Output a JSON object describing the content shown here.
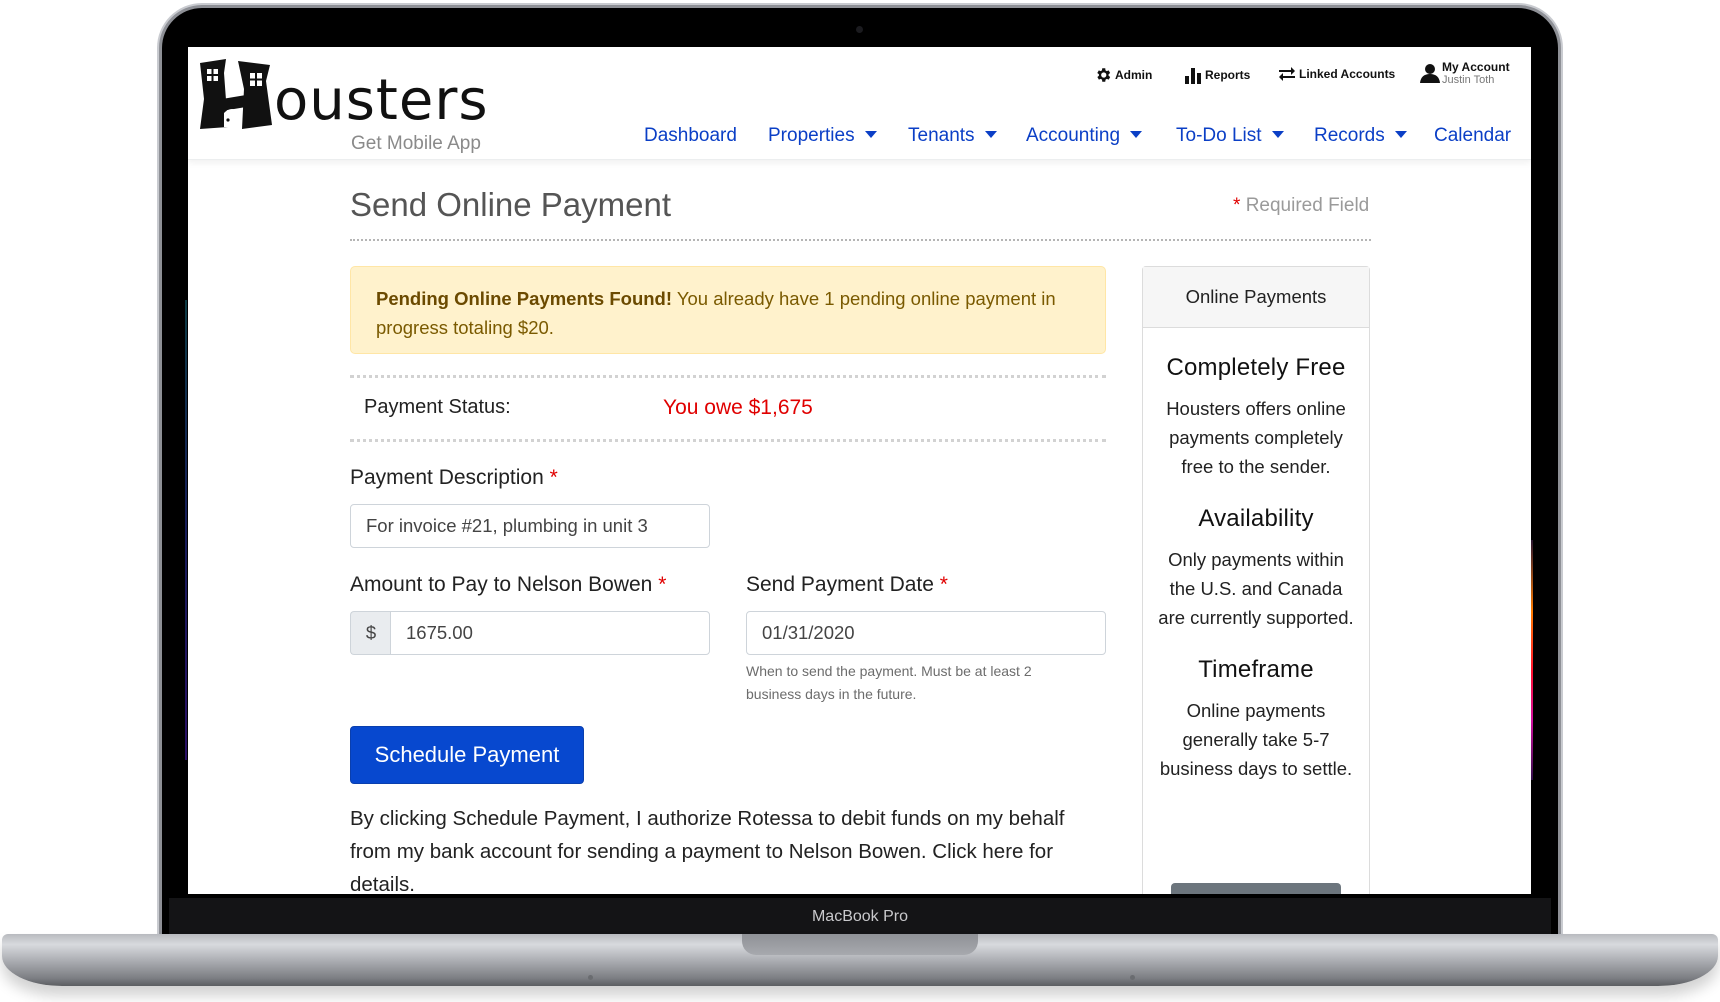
{
  "device": {
    "label": "MacBook Pro"
  },
  "header": {
    "logo_text": "ousters",
    "brand": "Housters",
    "mobile_link": "Get Mobile App",
    "utility": [
      {
        "icon": "gear-icon",
        "label": "Admin"
      },
      {
        "icon": "bar-chart-icon",
        "label": "Reports"
      },
      {
        "icon": "exchange-arrows-icon",
        "label": "Linked Accounts"
      }
    ],
    "account": {
      "icon": "user-icon",
      "title": "My Account",
      "name": "Justin Toth"
    },
    "nav": [
      {
        "label": "Dashboard",
        "dropdown": false
      },
      {
        "label": "Properties",
        "dropdown": true
      },
      {
        "label": "Tenants",
        "dropdown": true
      },
      {
        "label": "Accounting",
        "dropdown": true
      },
      {
        "label": "To-Do List",
        "dropdown": true
      },
      {
        "label": "Records",
        "dropdown": true
      },
      {
        "label": "Calendar",
        "dropdown": false
      }
    ]
  },
  "page": {
    "title": "Send Online Payment",
    "required_marker": "*",
    "required_note": "Required Field"
  },
  "alert": {
    "bold": "Pending Online Payments Found!",
    "text": " You already have 1 pending online payment in progress totaling $20."
  },
  "status": {
    "label": "Payment Status:",
    "value": "You owe $1,675"
  },
  "form": {
    "description": {
      "label": "Payment Description",
      "value": "For invoice #21, plumbing in unit 3"
    },
    "amount": {
      "label": "Amount to Pay to Nelson Bowen",
      "prefix": "$",
      "value": "1675.00"
    },
    "date": {
      "label": "Send Payment Date",
      "value": "01/31/2020",
      "help": "When to send the payment. Must be at least 2 business days in the future."
    },
    "submit_label": "Schedule Payment",
    "authorization": "By clicking Schedule Payment, I authorize Rotessa to debit funds on my behalf from my bank account for sending a payment to Nelson Bowen. Click here for details."
  },
  "sidebar": {
    "header": "Online Payments",
    "sections": [
      {
        "heading": "Completely Free",
        "text": "Housters offers online payments completely free to the sender."
      },
      {
        "heading": "Availability",
        "text": "Only payments within the U.S. and Canada are currently supported."
      },
      {
        "heading": "Timeframe",
        "text": "Online payments generally take 5-7 business days to settle."
      }
    ]
  },
  "colors": {
    "nav_link": "#0b3fc6",
    "primary_button": "#0748cf",
    "owed_amount": "#e00000",
    "alert_bg": "#fff2cc"
  }
}
